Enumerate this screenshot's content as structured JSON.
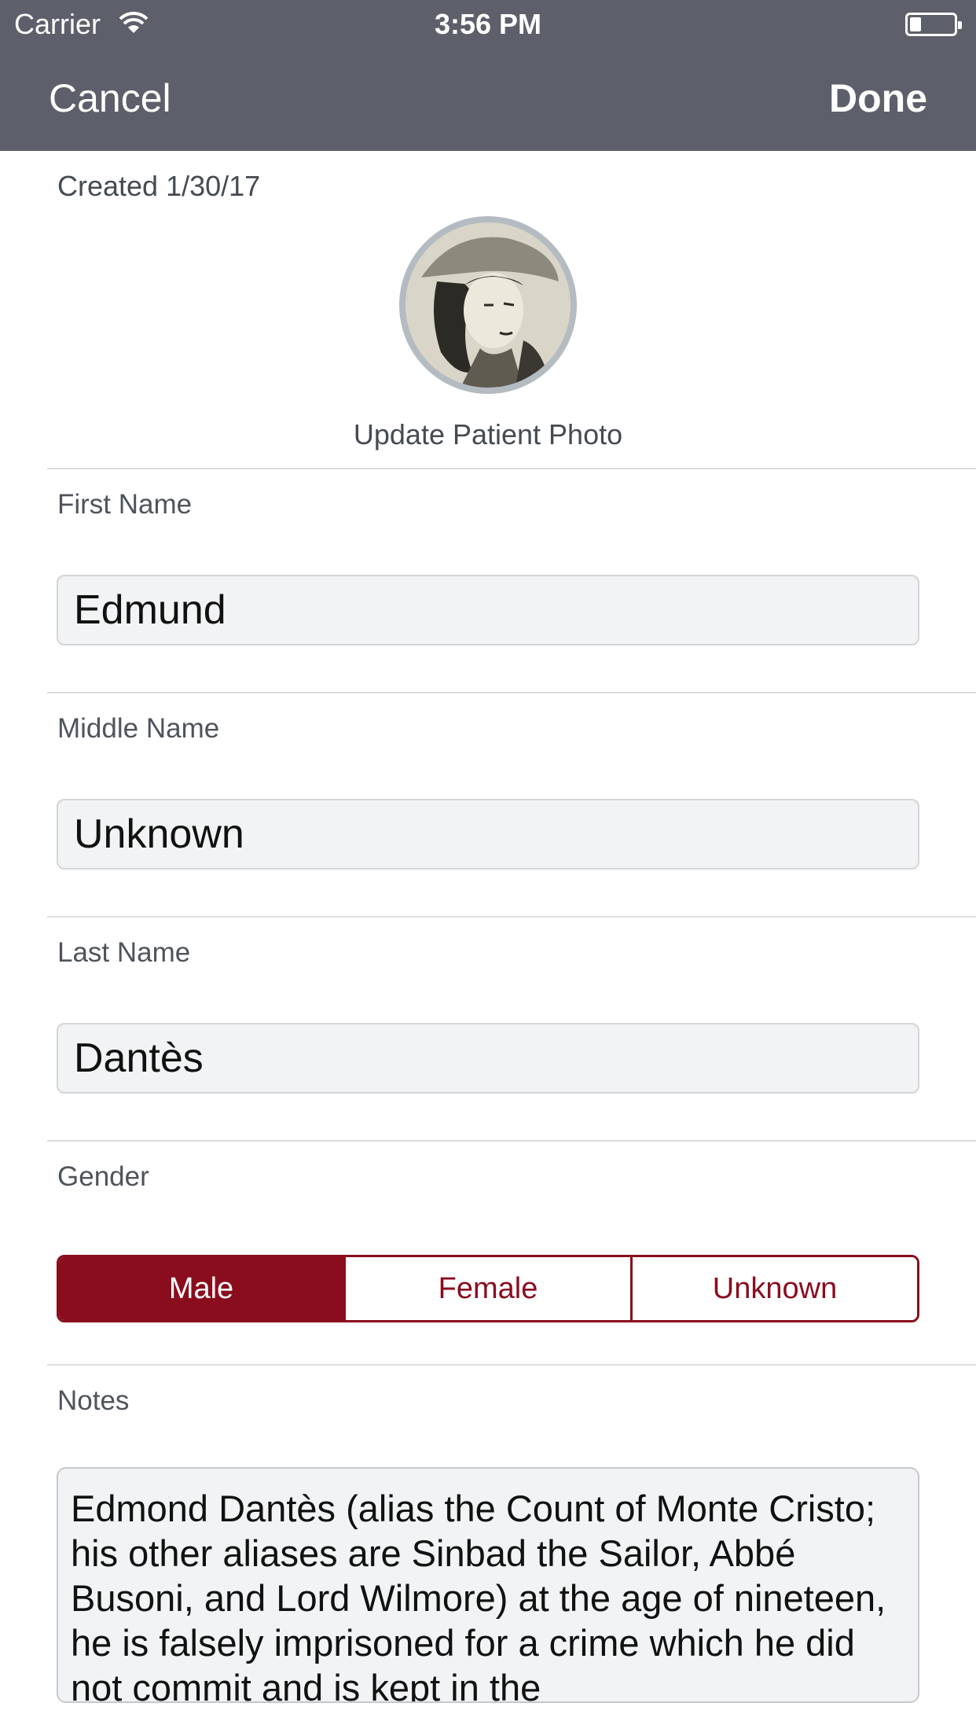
{
  "status_bar": {
    "carrier": "Carrier",
    "time": "3:56 PM"
  },
  "nav": {
    "cancel_label": "Cancel",
    "done_label": "Done"
  },
  "created_text": "Created 1/30/17",
  "photo": {
    "update_label": "Update Patient Photo"
  },
  "fields": {
    "first_name": {
      "label": "First Name",
      "value": "Edmund"
    },
    "middle_name": {
      "label": "Middle Name",
      "value": "Unknown"
    },
    "last_name": {
      "label": "Last Name",
      "value": "Dantès"
    }
  },
  "gender": {
    "label": "Gender",
    "options": [
      "Male",
      "Female",
      "Unknown"
    ],
    "selected": "Male"
  },
  "notes": {
    "label": "Notes",
    "value": "Edmond Dantès (alias the Count of Monte Cristo; his other aliases are Sinbad the Sailor, Abbé Busoni, and Lord Wilmore) at the age of nineteen, he is falsely imprisoned for a crime which he did not commit and is kept in the"
  },
  "colors": {
    "nav_bar": "#5d606b",
    "accent": "#8a0d1e",
    "input_bg": "#f1f3f4"
  }
}
